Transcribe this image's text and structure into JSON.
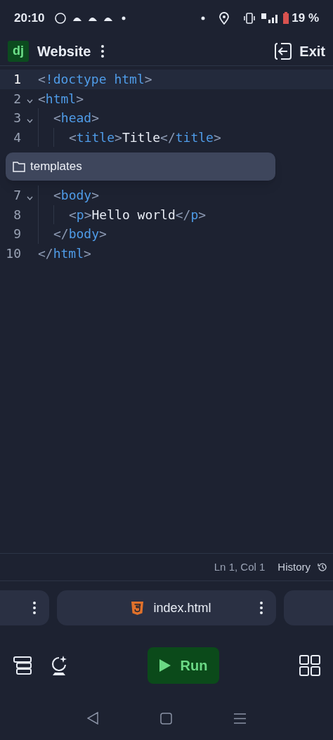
{
  "status_bar": {
    "time": "20:10",
    "battery": "19 %"
  },
  "app_bar": {
    "logo": "dj",
    "title": "Website",
    "exit_label": "Exit"
  },
  "editor": {
    "lines": [
      {
        "kind": "code",
        "number": "1",
        "current": true,
        "fold": false,
        "tokens": [
          {
            "kind": "punct",
            "text": "<"
          },
          {
            "kind": "tag",
            "text": "!doctype html"
          },
          {
            "kind": "punct",
            "text": ">"
          }
        ]
      },
      {
        "kind": "code",
        "number": "2",
        "current": false,
        "fold": true,
        "tokens": [
          {
            "kind": "punct",
            "text": "<"
          },
          {
            "kind": "tag",
            "text": "html"
          },
          {
            "kind": "punct",
            "text": ">"
          }
        ],
        "children": [
          {
            "kind": "code",
            "number": "3",
            "current": false,
            "fold": true,
            "tokens": [
              {
                "kind": "punct",
                "text": "<"
              },
              {
                "kind": "tag",
                "text": "head"
              },
              {
                "kind": "punct",
                "text": ">"
              }
            ],
            "children": [
              {
                "kind": "code",
                "number": "4",
                "current": false,
                "fold": false,
                "tokens": [
                  {
                    "kind": "punct",
                    "text": "<"
                  },
                  {
                    "kind": "tag",
                    "text": "title"
                  },
                  {
                    "kind": "punct",
                    "text": ">"
                  },
                  {
                    "kind": "text",
                    "text": "Title"
                  },
                  {
                    "kind": "punct",
                    "text": "</"
                  },
                  {
                    "kind": "tag",
                    "text": "title"
                  },
                  {
                    "kind": "punct",
                    "text": ">"
                  }
                ]
              },
              {
                "kind": "suggestion",
                "label": "templates"
              }
            ]
          },
          {
            "kind": "code",
            "number": "7",
            "current": false,
            "fold": true,
            "tokens": [
              {
                "kind": "punct",
                "text": "<"
              },
              {
                "kind": "tag",
                "text": "body"
              },
              {
                "kind": "punct",
                "text": ">"
              }
            ],
            "children": [
              {
                "kind": "code",
                "number": "8",
                "current": false,
                "fold": false,
                "tokens": [
                  {
                    "kind": "punct",
                    "text": "<"
                  },
                  {
                    "kind": "tag",
                    "text": "p"
                  },
                  {
                    "kind": "punct",
                    "text": ">"
                  },
                  {
                    "kind": "text",
                    "text": "Hello world"
                  },
                  {
                    "kind": "punct",
                    "text": "</"
                  },
                  {
                    "kind": "tag",
                    "text": "p"
                  },
                  {
                    "kind": "punct",
                    "text": ">"
                  }
                ]
              }
            ]
          },
          {
            "kind": "code",
            "number": "9",
            "current": false,
            "fold": false,
            "tokens": [
              {
                "kind": "punct",
                "text": "</"
              },
              {
                "kind": "tag",
                "text": "body"
              },
              {
                "kind": "punct",
                "text": ">"
              }
            ]
          }
        ]
      },
      {
        "kind": "code",
        "number": "10",
        "current": false,
        "fold": false,
        "tokens": [
          {
            "kind": "punct",
            "text": "</"
          },
          {
            "kind": "tag",
            "text": "html"
          },
          {
            "kind": "punct",
            "text": ">"
          }
        ]
      }
    ]
  },
  "footer": {
    "position": "Ln 1, Col 1",
    "history": "History"
  },
  "file_tabs": [
    {
      "kind": "partial-left"
    },
    {
      "kind": "full",
      "label": "index.html"
    },
    {
      "kind": "partial-right"
    }
  ],
  "toolbar": {
    "run": "Run"
  }
}
